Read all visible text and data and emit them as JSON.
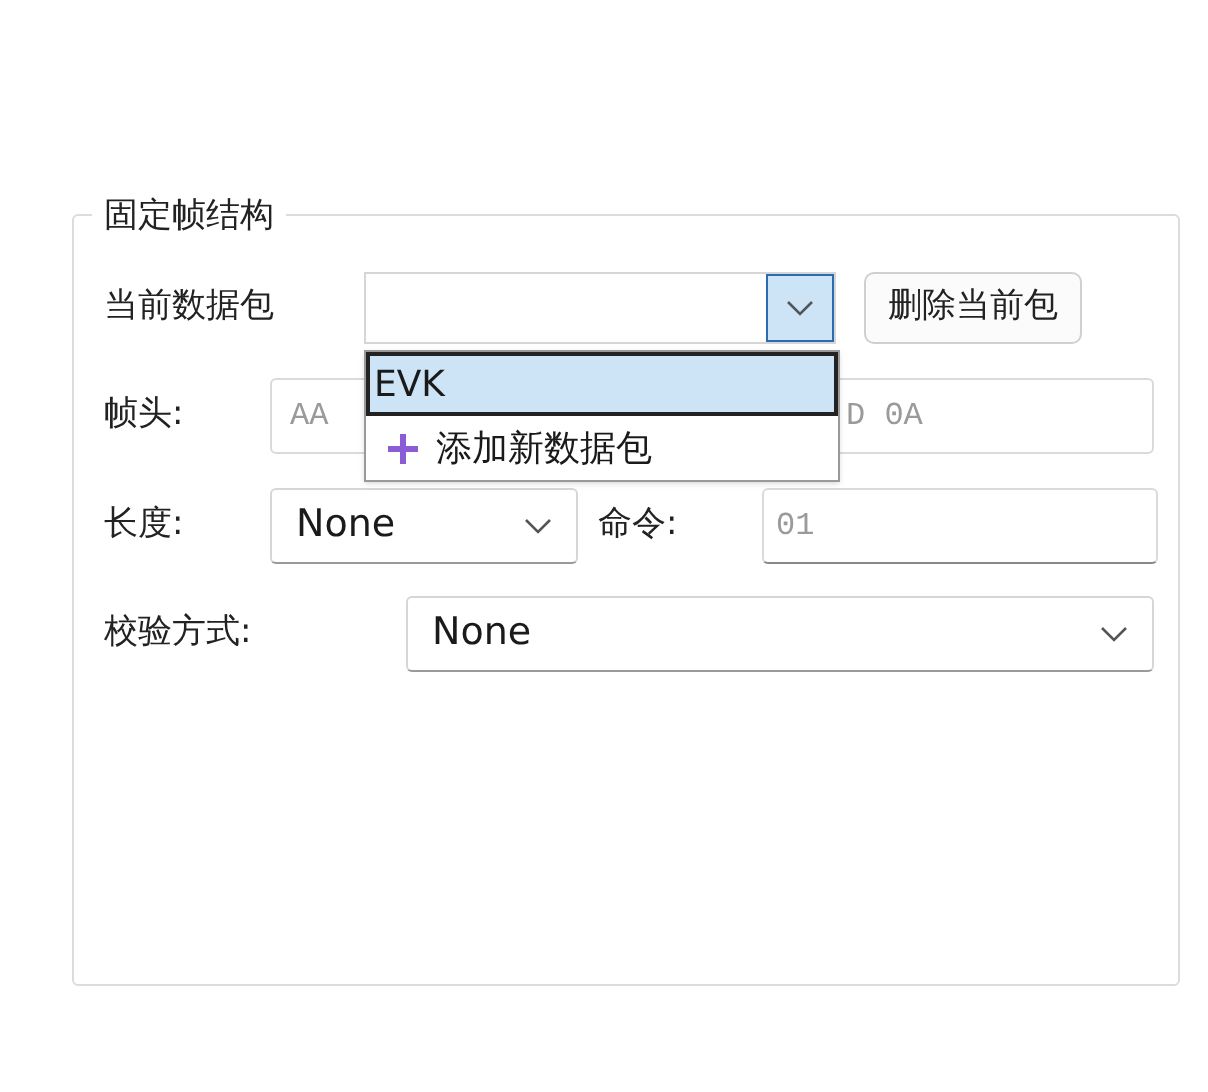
{
  "group": {
    "title": "固定帧结构"
  },
  "packet": {
    "label": "当前数据包",
    "expanded": true,
    "delete_button": "删除当前包"
  },
  "dropdown": {
    "items": [
      {
        "kind": "option",
        "label": "EVK",
        "selected": true
      },
      {
        "kind": "add",
        "label": "添加新数据包",
        "selected": false
      }
    ]
  },
  "header": {
    "label": "帧头:",
    "value_start": "AA",
    "value_end": "D 0A"
  },
  "length": {
    "label": "长度:",
    "value": "None"
  },
  "command": {
    "label": "命令:",
    "placeholder": "01"
  },
  "checksum": {
    "label": "校验方式:",
    "value": "None"
  }
}
